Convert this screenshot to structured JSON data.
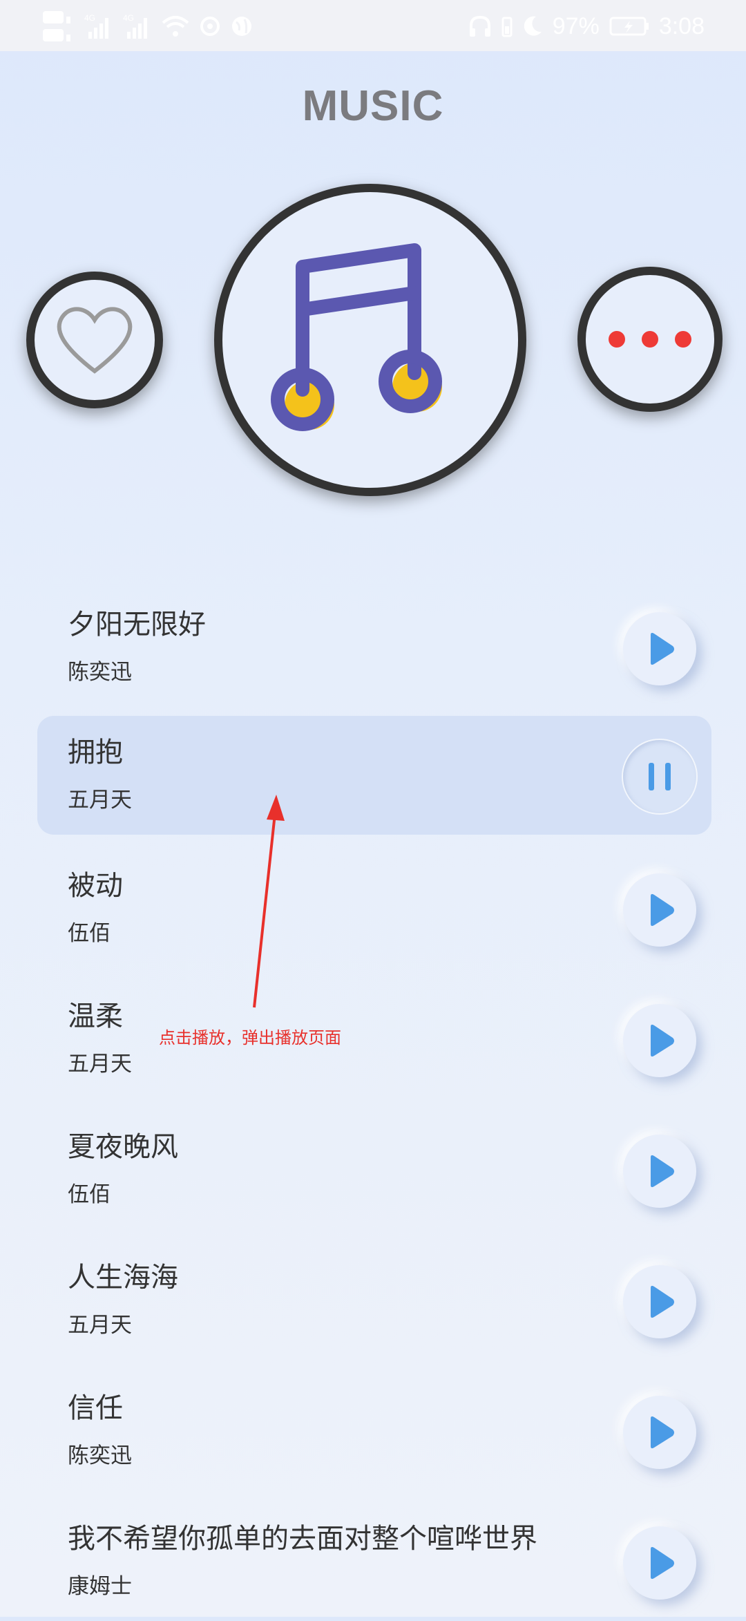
{
  "status_bar": {
    "battery_percent": "97%",
    "time": "3:08",
    "left_icons": [
      "hd-signal-icon",
      "4g-signal-icon",
      "4g-signal-icon",
      "wifi-icon",
      "sync-icon",
      "globe-icon"
    ],
    "right_icons": [
      "headphones-icon",
      "battery-small-icon",
      "moon-icon",
      "battery-icon"
    ]
  },
  "header": {
    "title": "MUSIC"
  },
  "controls": {
    "favorite_icon": "heart-icon",
    "disc_icon": "music-note-icon",
    "more_icon": "more-dots-icon",
    "accent_dots_color": "#ee3a36",
    "note_color": "#5b58b0",
    "note_fill_color": "#f4c21b"
  },
  "songs": [
    {
      "title": "夕阳无限好",
      "artist": "陈奕迅",
      "state": "play"
    },
    {
      "title": "拥抱",
      "artist": "五月天",
      "state": "pause"
    },
    {
      "title": "被动",
      "artist": "伍佰",
      "state": "play"
    },
    {
      "title": "温柔",
      "artist": "五月天",
      "state": "play"
    },
    {
      "title": "夏夜晚风",
      "artist": "伍佰",
      "state": "play"
    },
    {
      "title": "人生海海",
      "artist": "五月天",
      "state": "play"
    },
    {
      "title": "信任",
      "artist": "陈奕迅",
      "state": "play"
    },
    {
      "title": "我不希望你孤单的去面对整个喧哗世界",
      "artist": "康姆士",
      "state": "play"
    }
  ],
  "annotation": {
    "text": "点击播放，弹出播放页面",
    "color": "#e8302b"
  },
  "colors": {
    "play_blue": "#4a9be6"
  }
}
